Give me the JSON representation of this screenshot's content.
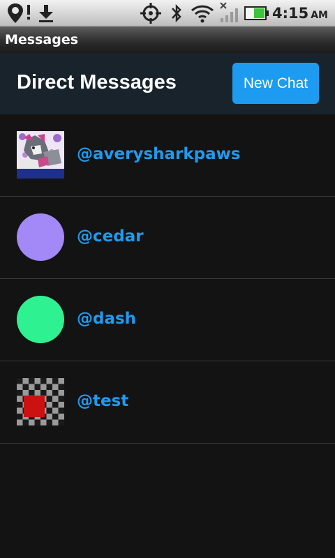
{
  "status_bar": {
    "time": "4:15",
    "ampm": "AM",
    "icons": [
      "location-alert-icon",
      "download-icon",
      "gps-icon",
      "bluetooth-icon",
      "wifi-icon",
      "signal-icon",
      "battery-icon"
    ]
  },
  "app_title": "Messages",
  "header": {
    "title": "Direct Messages",
    "new_chat_label": "New Chat"
  },
  "colors": {
    "accent": "#1d9bf0",
    "background": "#131313",
    "header_bg": "#19232c",
    "avatar_cedar": "#a388f7",
    "avatar_dash": "#2ef292",
    "avatar_test_red": "#cc1111"
  },
  "conversations": [
    {
      "handle": "@averysharkpaws",
      "avatar": "photo"
    },
    {
      "handle": "@cedar",
      "avatar": "circle"
    },
    {
      "handle": "@dash",
      "avatar": "circle"
    },
    {
      "handle": "@test",
      "avatar": "checkerboard"
    }
  ]
}
